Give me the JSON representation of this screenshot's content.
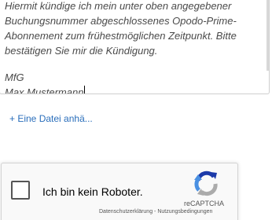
{
  "message": {
    "lines": [
      "Hiermit kündige ich mein unter oben angegebener",
      "Buchungsnummer abgeschlossenes Opodo-Prime-",
      "Abonnement zum frühestmöglichen Zeitpunkt. Bitte",
      "bestätigen Sie mir die Kündigung.",
      "",
      "MfG",
      "Max Mustermann"
    ]
  },
  "attach": {
    "label": "+ Eine Datei anhä..."
  },
  "recaptcha": {
    "label": "Ich bin kein Roboter.",
    "brand": "reCAPTCHA",
    "privacy": "Datenschutzerklärung",
    "separator": " - ",
    "terms": "Nutzungsbedingungen",
    "checked": false
  },
  "colors": {
    "link": "#2a6ebb",
    "text": "#4a4a4a",
    "recaptcha_blue": "#4a90e2",
    "recaptcha_dark_blue": "#1c3aa9",
    "recaptcha_gray": "#ababab"
  },
  "icons": {
    "recaptcha_logo": "recaptcha-logo-icon",
    "text_caret": "text-caret"
  }
}
